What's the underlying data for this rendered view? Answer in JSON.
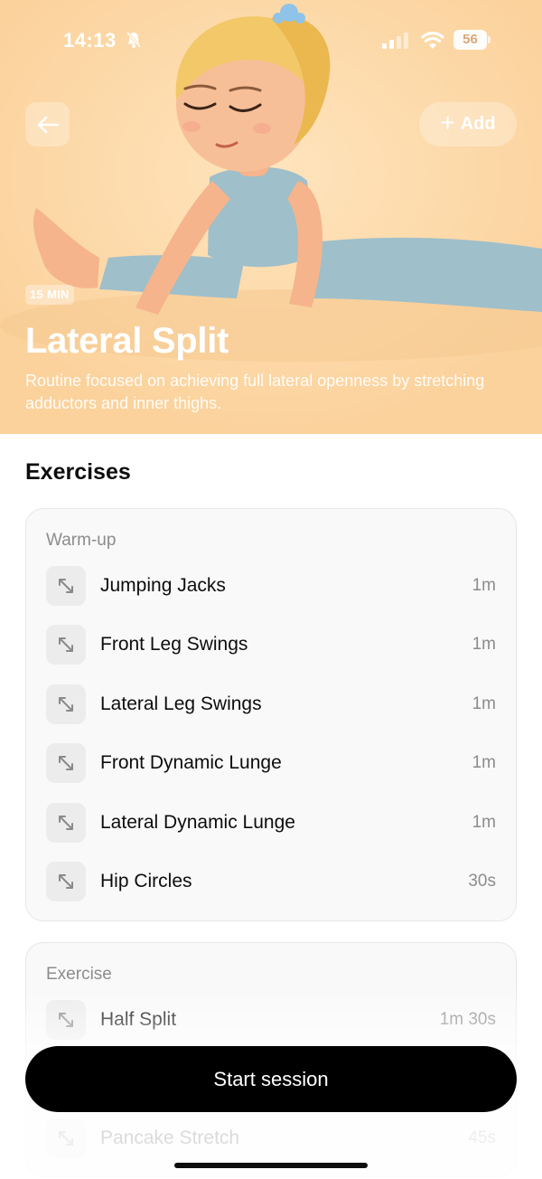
{
  "status_bar": {
    "time": "14:13",
    "battery": "56"
  },
  "header": {
    "add_label": "Add",
    "duration": "15 MIN",
    "title": "Lateral Split",
    "description": "Routine focused on achieving full lateral openness by stretching adductors and inner thighs."
  },
  "exercises": {
    "section_title": "Exercises",
    "groups": [
      {
        "label": "Warm-up",
        "items": [
          {
            "name": "Jumping Jacks",
            "duration": "1m"
          },
          {
            "name": "Front Leg Swings",
            "duration": "1m"
          },
          {
            "name": "Lateral Leg Swings",
            "duration": "1m"
          },
          {
            "name": "Front Dynamic Lunge",
            "duration": "1m"
          },
          {
            "name": "Lateral Dynamic Lunge",
            "duration": "1m"
          },
          {
            "name": "Hip Circles",
            "duration": "30s"
          }
        ]
      },
      {
        "label": "Exercise",
        "items": [
          {
            "name": "Half Split",
            "duration": "1m 30s"
          },
          {
            "name": "Pancake Stretch",
            "duration": "45s"
          }
        ]
      }
    ]
  },
  "actions": {
    "start_label": "Start session"
  },
  "icons": {
    "back": "arrow-left-icon",
    "add": "plus-icon",
    "exercise_item": "expand-arrows-icon",
    "silent": "bell-slash-icon",
    "signal": "signal-bars-icon",
    "wifi": "wifi-icon"
  },
  "colors": {
    "hero_background": "#fdd9a6",
    "primary_button": "#000000",
    "card_background": "#f9f9f9"
  }
}
